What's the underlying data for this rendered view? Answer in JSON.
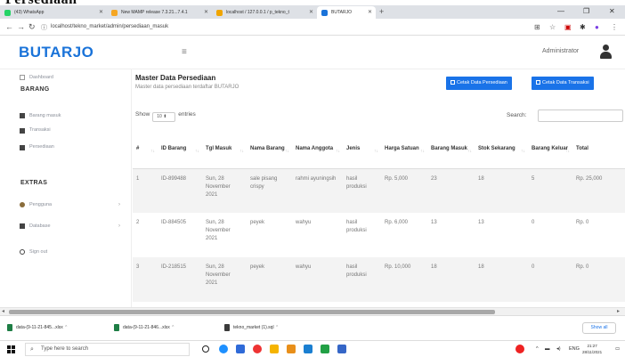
{
  "browser": {
    "tabs": [
      {
        "title": "(43) WhatsApp",
        "active": false
      },
      {
        "title": "New MAMP release 7.3.21...7.4.1",
        "active": false
      },
      {
        "title": "localhost / 127.0.0.1 / p_tekno_t",
        "active": false
      },
      {
        "title": "BUTARJO",
        "active": true
      }
    ],
    "url": "localhost/tekno_market/admin/persediaan_masuk"
  },
  "header": {
    "logo": "BUTARJO",
    "user": "Administrator"
  },
  "sidebar": {
    "items_top": [
      {
        "label": "Dashboard",
        "icon": "monitor-icon"
      }
    ],
    "section_barang": "BARANG",
    "items_barang": [
      {
        "label": "Barang masuk",
        "icon": "box-icon"
      },
      {
        "label": "Transaksi",
        "icon": "cart-icon"
      },
      {
        "label": "Persediaan",
        "icon": "grid-icon"
      }
    ],
    "section_extras": "EXTRAS",
    "items_extras": [
      {
        "label": "Pengguna",
        "icon": "users-icon",
        "chevron": "›"
      },
      {
        "label": "Database",
        "icon": "database-icon",
        "chevron": "›"
      },
      {
        "label": "Sign out",
        "icon": "power-icon"
      }
    ]
  },
  "page": {
    "title": "Master Data Persediaan",
    "subtitle": "Master data persediaan terdaftar BUTARJO",
    "btn_print_stock": "Cetak Data Persediaan",
    "btn_print_trans": "Cetak Data Transaksi",
    "show_label": "Show",
    "show_value": "10",
    "entries_label": "entries",
    "search_label": "Search:"
  },
  "table": {
    "headers": [
      "#",
      "ID Barang",
      "Tgl Masuk",
      "Nama Barang",
      "Nama Anggota",
      "Jenis",
      "Harga Satuan",
      "Barang Masuk",
      "Stok Sekarang",
      "Barang Keluar",
      "Total"
    ],
    "rows": [
      [
        "1",
        "ID-899488",
        "Sun, 28 November 2021",
        "sale pisang crispy",
        "rahmi ayuningsih",
        "hasil produksi",
        "Rp. 5,000",
        "23",
        "18",
        "5",
        "Rp. 25,000"
      ],
      [
        "2",
        "ID-884505",
        "Sun, 28 November 2021",
        "peyek",
        "wahyu",
        "hasil produksi",
        "Rp. 6,000",
        "13",
        "13",
        "0",
        "Rp. 0"
      ],
      [
        "3",
        "ID-218515",
        "Sun, 28 November 2021",
        "peyek",
        "wahyu",
        "hasil produksi",
        "Rp. 10,000",
        "18",
        "18",
        "0",
        "Rp. 0"
      ]
    ]
  },
  "downloads": {
    "items": [
      "data-(9-11-21-845...xlsx",
      "data-(9-11-21-846...xlsx",
      "tekno_market (1).sql"
    ],
    "show_all": "Show all"
  },
  "taskbar": {
    "search_placeholder": "Type here to search",
    "time": "21:27",
    "date": "28/11/2021",
    "lang": "ENG"
  }
}
